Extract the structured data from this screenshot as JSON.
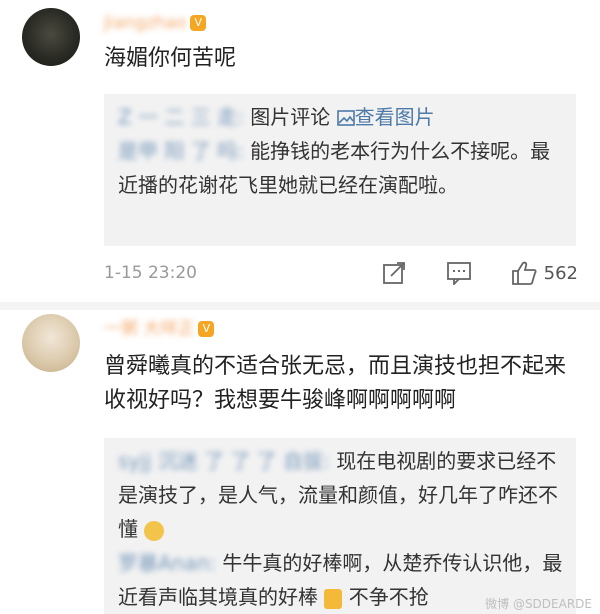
{
  "comment1": {
    "username": "Jiangzhao",
    "text": "海媚你何苦呢",
    "replies": [
      {
        "name": "Z 一 二 三 走:",
        "segments": [
          "图片评论",
          "查看图片"
        ]
      },
      {
        "name": "是甲 阳 了 吗:",
        "text": "能挣钱的老本行为什么不接呢。最近播的花谢花飞里她就已经在演配啦。"
      }
    ],
    "timestamp": "1-15 23:20",
    "like_count": "562"
  },
  "comment2": {
    "username": "一粥 大咩正",
    "text": "曾舜曦真的不适合张无忌，而且演技也担不起来收视好吗？我想要牛骏峰啊啊啊啊啊",
    "replies": [
      {
        "name": "syjj 沉迷 了 了 了 自拔:",
        "text": "现在电视剧的要求已经不是演技了，是人气，流量和颜值，好几年了咋还不懂"
      },
      {
        "name": "罗暴Anan:",
        "text": "牛牛真的好棒啊，从楚乔传认识他，最近看声临其境真的好棒",
        "tail": "不争不抢"
      }
    ]
  },
  "watermark": "微博 @SDDEARDE",
  "icons": {
    "share": "share-icon",
    "comment": "comment-icon",
    "like": "thumb-up-icon",
    "image": "image-icon"
  },
  "colors": {
    "username": "#f08d3a",
    "reply_name": "#4d7aa8",
    "quote_bg": "#f2f2f2"
  }
}
